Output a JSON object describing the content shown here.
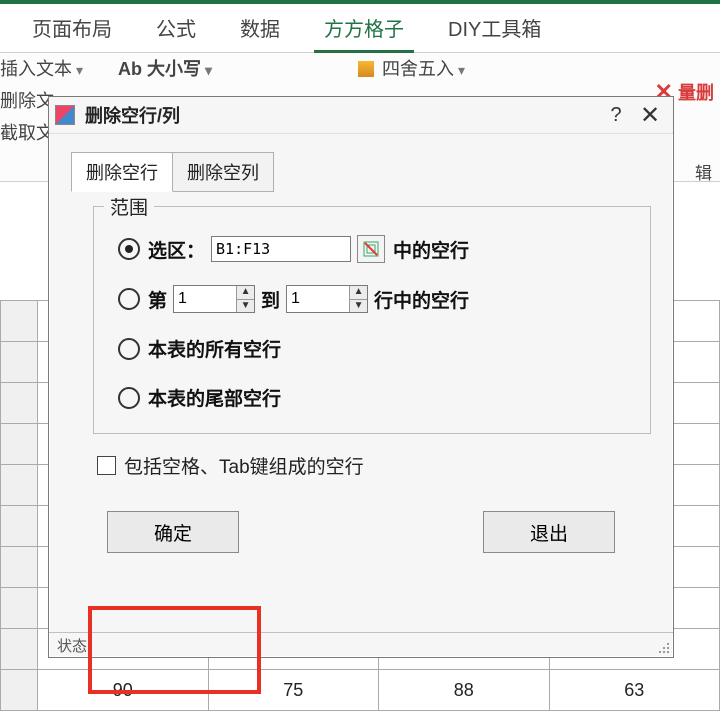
{
  "ribbon": {
    "tabs": [
      "页面布局",
      "公式",
      "数据",
      "方方格子",
      "DIY工具箱"
    ],
    "active_index": 3,
    "buttons": {
      "insert_text": "插入文本",
      "delete_text": "删除文",
      "extract_text": "截取文",
      "case": "Ab 大小写",
      "round": "四舍五入",
      "bulk_del": "量删",
      "editor_group": "辑"
    }
  },
  "dialog": {
    "title": "删除空行/列",
    "tabs": {
      "rows": "删除空行",
      "cols": "删除空列"
    },
    "group_legend": "范围",
    "opt_selection_label": "选区：",
    "opt_selection_value": "B1:F13",
    "opt_selection_suffix": "中的空行",
    "opt_range_prefix": "第",
    "opt_range_from": "1",
    "opt_range_mid": "到",
    "opt_range_to": "1",
    "opt_range_suffix": "行中的空行",
    "opt_all": "本表的所有空行",
    "opt_tail": "本表的尾部空行",
    "chk_spaces": "包括空格、Tab键组成的空行",
    "btn_ok": "确定",
    "btn_exit": "退出",
    "status_label": "状态："
  },
  "table": {
    "cells": [
      "90",
      "75",
      "88",
      "63"
    ]
  }
}
